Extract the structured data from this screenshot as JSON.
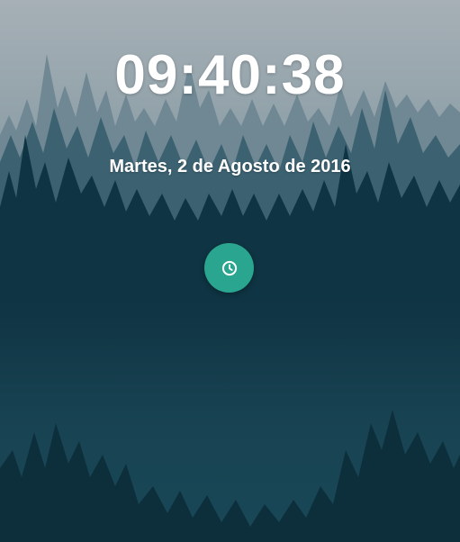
{
  "clock": {
    "time": "09:40:38",
    "date": "Martes, 2 de Agosto de 2016"
  },
  "alarm_button": {
    "icon": "clock-icon",
    "color": "#2aa58f"
  },
  "colors": {
    "sky": "#a3adb3",
    "forest_dark": "#0f3443",
    "forest_mid": "#2e5564",
    "forest_far": "#5f7b88"
  }
}
